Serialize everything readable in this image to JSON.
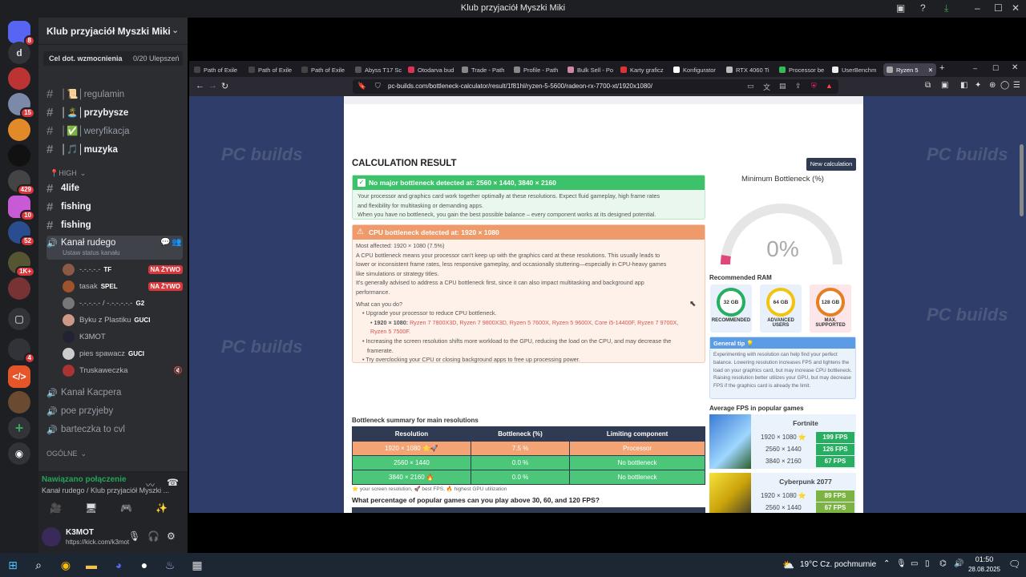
{
  "window": {
    "title": "Klub przyjaciół Myszki Miki"
  },
  "server_rail": {
    "badges": [
      "8",
      "15",
      "429",
      "10",
      "52",
      "1K+",
      "4"
    ],
    "initial": "d"
  },
  "sidebar": {
    "guild_name": "Klub przyjaciół Myszki Miki",
    "boost_label": "Cel dot. wzmocnienia",
    "boost_value": "0/20 Ulepszeń",
    "channels": [
      {
        "name": "│📜│regulamin"
      },
      {
        "name": "│🏝️│przybysze"
      },
      {
        "name": "│✅│weryfikacja"
      },
      {
        "name": "│🎵│muzyka"
      }
    ],
    "category_high": "📍HIGH",
    "channels2": [
      {
        "name": "4life"
      },
      {
        "name": "fishing"
      },
      {
        "name": "fishing"
      }
    ],
    "active_voice": "Kanał rudego",
    "voice_status": "Ustaw status kanału",
    "members": [
      {
        "name": "-.-.-.-.-",
        "tag": "TF",
        "live": "NA ŻYWO"
      },
      {
        "name": "tasak",
        "tag": "SPEL",
        "live": "NA ŻYWO"
      },
      {
        "name": "-.-.-.-.- / -.-.-.-.-.-",
        "tag": "G2",
        "live": ""
      },
      {
        "name": "Byku z Plastiku",
        "tag": "GUCI",
        "live": ""
      },
      {
        "name": "K3MOT",
        "tag": "",
        "live": ""
      },
      {
        "name": "pies spawacz",
        "tag": "GUCI",
        "live": ""
      },
      {
        "name": "Truskaweczka",
        "tag": "",
        "live": ""
      }
    ],
    "voice_channels": [
      "Kanał Kacpera",
      "poe przyjeby",
      "barteczka to cvl"
    ],
    "category_general": "OGÓLNE",
    "voice_connected": "Nawiązano połączenie",
    "voice_location": "Kanał rudego / Klub przyjaciół Myszki ...",
    "user_name": "K3MOT",
    "user_status": "https://kick.com/k3mot"
  },
  "browser": {
    "tabs": [
      "Path of Exile",
      "Path of Exile",
      "Path of Exile",
      "Abyss T17 Sc",
      "Otodarva bud",
      "Trade - Path",
      "Profile - Path",
      "Bulk Sell - Po",
      "Karty graficz",
      "Konfigurator",
      "RTX 4060 Ti",
      "Processor be",
      "UserBenchm",
      "Ryzen 5"
    ],
    "url": "pc-builds.com/bottleneck-calculator/result/1f81hl/ryzen-5-5600/radeon-rx-7700-xt/1920x1080/"
  },
  "page": {
    "watermark": "PC builds",
    "title": "CALCULATION RESULT",
    "new_calc": "New calculation",
    "green_box": {
      "heading": "No major bottleneck detected at: 2560 × 1440, 3840 × 2160",
      "line1": "Your processor and graphics card work together optimally at these resolutions. Expect fluid gameplay, high frame rates",
      "line2": "and flexibility for multitasking or demanding apps.",
      "line3": "When you have no bottleneck, you gain the best possible balance – every component works at its designed potential."
    },
    "orange_box": {
      "heading": "CPU bottleneck detected at: 1920 × 1080",
      "affected": "Most affected: 1920 × 1080 (7.5%)",
      "p1a": "A CPU bottleneck means your processor can't keep up with the graphics card at these resolutions. This usually leads to",
      "p1b": "lower or inconsistent frame rates, less responsive gameplay, and occasionally stuttering—especially in CPU-heavy games",
      "p1c": "like simulations or strategy titles.",
      "p2a": "It's generally advised to address a CPU bottleneck first, since it can also impact multitasking and background app",
      "p2b": "performance.",
      "what": "What can you do?",
      "b1": "Upgrade your processor to reduce CPU bottleneck.",
      "b1_res": "1920 × 1080:",
      "b1_cpus_a": "Ryzen 7 7800X3D, Ryzen 7 9800X3D, Ryzen 5 7600X, Ryzen 5 9600X, Core i5-14400F, Ryzen 7 9700X,",
      "b1_cpus_b": "Ryzen 5 7500F.",
      "b2a": "Increasing the screen resolution shifts more workload to the GPU, reducing the load on the CPU, and may decrease the",
      "b2b": "framerate.",
      "b3": "Try overclocking your CPU or closing background apps to free up processing power."
    },
    "summary_title": "Bottleneck summary for main resolutions",
    "summary_headers": [
      "Resolution",
      "Bottleneck (%)",
      "Limiting component"
    ],
    "summary_rows": [
      {
        "res": "1920 × 1080 ⭐🚀",
        "pct": "7.5 %",
        "comp": "Processor"
      },
      {
        "res": "2560 × 1440",
        "pct": "0.0 %",
        "comp": "No bottleneck"
      },
      {
        "res": "3840 × 2160 🔥",
        "pct": "0.0 %",
        "comp": "No bottleneck"
      }
    ],
    "legend": "⭐ your screen resolution, 🚀 best FPS, 🔥 highest GPU utilization",
    "fps_question": "What percentage of popular games can you play above 30, 60, and 120 FPS?",
    "min_bottleneck_title": "Minimum Bottleneck (%)",
    "min_bottleneck_value": "0%",
    "min_bottleneck_fraction": 0.0,
    "ram_title": "Recommended RAM",
    "ram": [
      {
        "size": "32 GB",
        "label": "RECOMMENDED",
        "color": "#27ae60"
      },
      {
        "size": "64 GB",
        "label": "ADVANCED USERS",
        "color": "#f1c40f"
      },
      {
        "size": "128 GB",
        "label": "MAX. SUPPORTED",
        "color": "#e67e22"
      }
    ],
    "tip_title": "General tip 💡",
    "tip_text": "Experimenting with resolution can help find your perfect balance. Lowering resolution increases FPS and lightens the load on your graphics card, but may increase CPU bottleneck. Raising resolution better utilizes your GPU, but may decrease FPS if the graphics card is already the limit.",
    "avg_fps_title": "Average FPS in popular games",
    "games": [
      {
        "name": "Fortnite",
        "rows": [
          {
            "res": "1920 × 1080 ⭐",
            "fps": "199 FPS"
          },
          {
            "res": "2560 × 1440",
            "fps": "126 FPS"
          },
          {
            "res": "3840 × 2160",
            "fps": "67 FPS"
          }
        ]
      },
      {
        "name": "Cyberpunk 2077",
        "rows": [
          {
            "res": "1920 × 1080 ⭐",
            "fps": "89 FPS"
          },
          {
            "res": "2560 × 1440",
            "fps": "67 FPS"
          }
        ]
      }
    ]
  },
  "taskbar": {
    "weather": "19°C  Cz. pochmurnie",
    "time": "01:50",
    "date": "28.08.2025"
  }
}
